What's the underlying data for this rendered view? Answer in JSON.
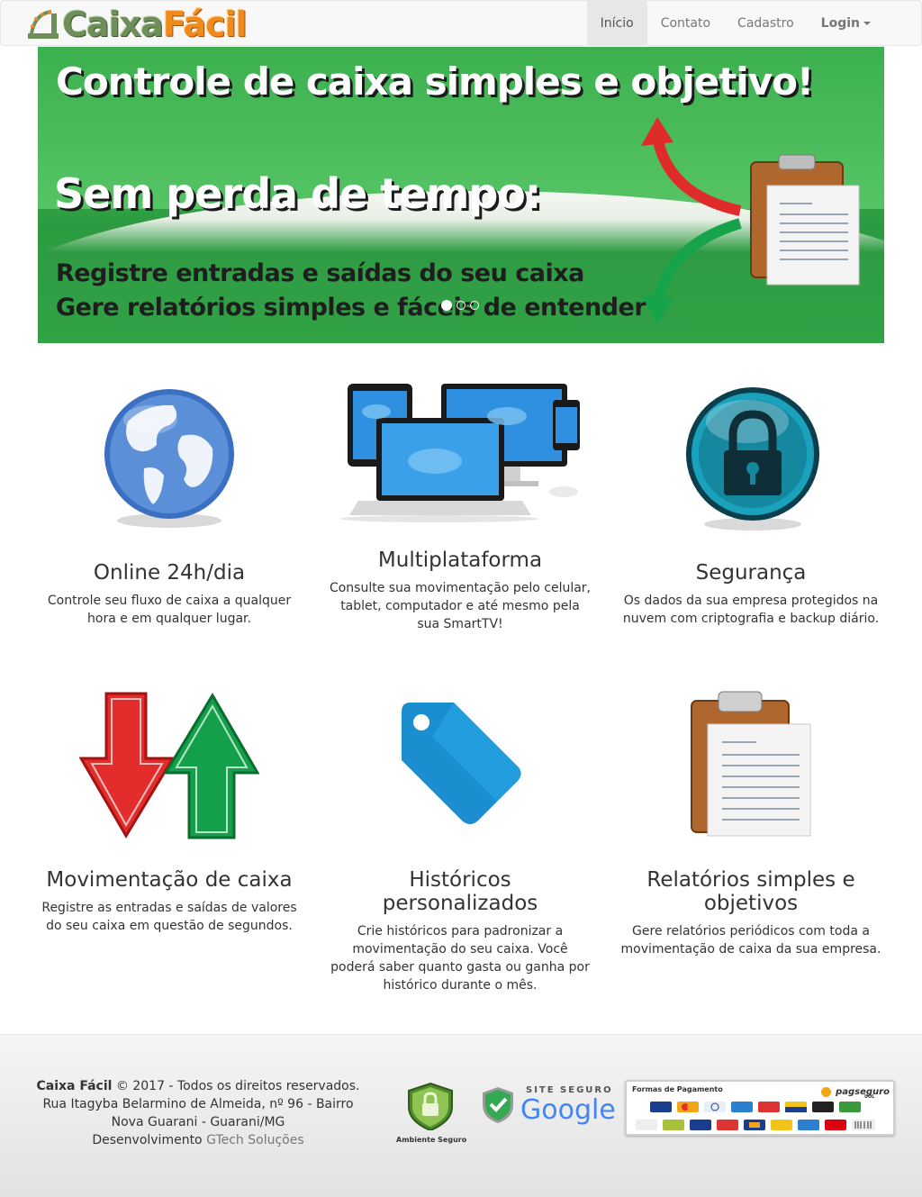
{
  "brand": {
    "name_part1": "Caixa",
    "name_part2": "Fácil"
  },
  "nav": {
    "items": [
      {
        "label": "Início",
        "active": true
      },
      {
        "label": "Contato",
        "active": false
      },
      {
        "label": "Cadastro",
        "active": false
      }
    ],
    "login_label": "Login"
  },
  "carousel": {
    "headline": "Controle de caixa simples e objetivo!",
    "subheadline": "Sem perda de tempo:",
    "line1": "Registre entradas e saídas do seu caixa",
    "line2": "Gere relatórios simples e fáceis de entender",
    "active_slide": 1,
    "slide_count": 3
  },
  "features": [
    {
      "icon": "globe-icon",
      "title": "Online 24h/dia",
      "text": "Controle seu fluxo de caixa a qualquer hora e em qualquer lugar."
    },
    {
      "icon": "devices-icon",
      "title": "Multiplataforma",
      "text": "Consulte sua movimentação pelo celular, tablet, computador e até mesmo pela sua SmartTV!"
    },
    {
      "icon": "lock-icon",
      "title": "Segurança",
      "text": "Os dados da sua empresa protegidos na nuvem com criptografia e backup diário."
    },
    {
      "icon": "up-down-arrows-icon",
      "title": "Movimentação de caixa",
      "text": "Registre as entradas e saídas de valores do seu caixa em questão de segundos."
    },
    {
      "icon": "tag-icon",
      "title": "Históricos personalizados",
      "text": "Crie históricos para padronizar a movimentação do seu caixa. Você poderá saber quanto gasta ou ganha por histórico durante o mês."
    },
    {
      "icon": "clipboard-icon",
      "title": "Relatórios simples e objetivos",
      "text": "Gere relatórios periódicos com toda a movimentação de caixa da sua empresa."
    }
  ],
  "footer": {
    "company": "Caixa Fácil",
    "copyright": "© 2017 - Todos os direitos reservados.",
    "address": "Rua Itagyba Belarmino de Almeida, nº 96 - Bairro Nova Guarani - Guarani/MG",
    "dev_prefix": "Desenvolvimento",
    "dev_link": "GTech Soluções",
    "seal_ambiente": "Ambiente Seguro",
    "seal_google_top": "SITE SEGURO",
    "seal_google_brand": "Google",
    "payment_title": "Formas de Pagamento",
    "payment_brand": "pagseguro",
    "payment_brand_sub": "UOL"
  },
  "colors": {
    "brand_green": "#6f8f5a",
    "brand_orange": "#f08a1c",
    "carousel_green": "#3fb050",
    "nav_active_bg": "#e7e7e7"
  }
}
